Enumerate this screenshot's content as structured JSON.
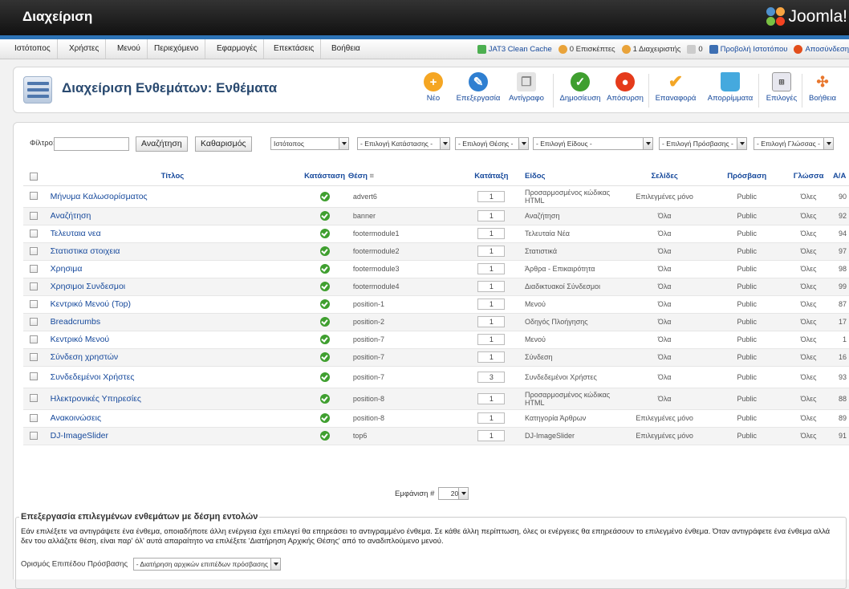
{
  "header": {
    "title": "Διαχείριση",
    "logo_text": "Joomla!"
  },
  "menu": [
    "Ιστότοπος",
    "Χρήστες",
    "Μενού",
    "Περιεχόμενο",
    "Εφαρμογές",
    "Επεκτάσεις",
    "Βοήθεια"
  ],
  "status": {
    "cache": "JAT3 Clean Cache",
    "visitors": "0 Επισκέπτες",
    "admins": "1 Διαχειριστής",
    "messages": "0",
    "view_site": "Προβολή Ιστοτόπου",
    "logout": "Αποσύνδεση"
  },
  "toolbar": {
    "page_title": "Διαχείριση Ενθεμάτων: Ενθέματα",
    "buttons": [
      "Νέο",
      "Επεξεργασία",
      "Αντίγραφο",
      "Δημοσίευση",
      "Απόσυρση",
      "Επαναφορά",
      "Απορρίμματα",
      "Επιλογές",
      "Βοήθεια"
    ]
  },
  "filter": {
    "label": "Φίλτρο:",
    "value": "",
    "search_button": "Αναζήτηση",
    "clear_button": "Καθαρισμός",
    "site_select": "Ιστότοπος",
    "state_select": "- Επιλογή Κατάστασης -",
    "position_select": "- Επιλογή Θέσης -",
    "type_select": "- Επιλογή Είδους -",
    "access_select": "- Επιλογή Πρόσβασης -",
    "language_select": "- Επιλογή Γλώσσας -"
  },
  "table": {
    "headers": {
      "title": "Τίτλος",
      "status": "Κατάσταση",
      "position": "Θέση",
      "ordering": "Κατάταξη",
      "type": "Είδος",
      "pages": "Σελίδες",
      "access": "Πρόσβαση",
      "language": "Γλώσσα",
      "id": "Α/Α"
    },
    "rows": [
      {
        "title": "Μήνυμα Καλωσορίσματος",
        "position": "advert6",
        "order": "1",
        "type": "Προσαρμοσμένος κώδικας HTML",
        "pages": "Επιλεγμένες μόνο",
        "access": "Public",
        "lang": "Όλες",
        "id": "90"
      },
      {
        "title": "Αναζήτηση",
        "position": "banner",
        "order": "1",
        "type": "Αναζήτηση",
        "pages": "Όλα",
        "access": "Public",
        "lang": "Όλες",
        "id": "92"
      },
      {
        "title": "Τελευταια νεα",
        "position": "footermodule1",
        "order": "1",
        "type": "Τελευταία Νέα",
        "pages": "Όλα",
        "access": "Public",
        "lang": "Όλες",
        "id": "94"
      },
      {
        "title": "Στατιστικα στοιχεια",
        "position": "footermodule2",
        "order": "1",
        "type": "Στατιστικά",
        "pages": "Όλα",
        "access": "Public",
        "lang": "Όλες",
        "id": "97"
      },
      {
        "title": "Χρησιμα",
        "position": "footermodule3",
        "order": "1",
        "type": "Άρθρα - Επικαιρότητα",
        "pages": "Όλα",
        "access": "Public",
        "lang": "Όλες",
        "id": "98"
      },
      {
        "title": "Χρησιμοι Συνδεσμοι",
        "position": "footermodule4",
        "order": "1",
        "type": "Διαδικτυακοί Σύνδεσμοι",
        "pages": "Όλα",
        "access": "Public",
        "lang": "Όλες",
        "id": "99"
      },
      {
        "title": "Κεντρικό Μενού (Top)",
        "position": "position-1",
        "order": "1",
        "type": "Μενού",
        "pages": "Όλα",
        "access": "Public",
        "lang": "Όλες",
        "id": "87"
      },
      {
        "title": "Breadcrumbs",
        "position": "position-2",
        "order": "1",
        "type": "Οδηγός Πλοήγησης",
        "pages": "Όλα",
        "access": "Public",
        "lang": "Όλες",
        "id": "17"
      },
      {
        "title": "Κεντρικό Μενού",
        "position": "position-7",
        "order": "1",
        "type": "Μενού",
        "pages": "Όλα",
        "access": "Public",
        "lang": "Όλες",
        "id": "1"
      },
      {
        "title": "Σύνδεση χρηστών",
        "position": "position-7",
        "order": "1",
        "type": "Σύνδεση",
        "pages": "Όλα",
        "access": "Public",
        "lang": "Όλες",
        "id": "16"
      },
      {
        "title": "Συνδεδεμένοι Χρήστες",
        "position": "position-7",
        "order": "3",
        "type": "Συνδεδεμένοι Χρήστες",
        "pages": "Όλα",
        "access": "Public",
        "lang": "Όλες",
        "id": "93"
      },
      {
        "title": "Ηλεκτρονικές Υπηρεσίες",
        "position": "position-8",
        "order": "1",
        "type": "Προσαρμοσμένος κώδικας HTML",
        "pages": "Όλα",
        "access": "Public",
        "lang": "Όλες",
        "id": "88"
      },
      {
        "title": "Ανακοινώσεις",
        "position": "position-8",
        "order": "1",
        "type": "Κατηγορία Άρθρων",
        "pages": "Επιλεγμένες μόνο",
        "access": "Public",
        "lang": "Όλες",
        "id": "89"
      },
      {
        "title": "DJ-ImageSlider",
        "position": "top6",
        "order": "1",
        "type": "DJ-ImageSlider",
        "pages": "Επιλεγμένες μόνο",
        "access": "Public",
        "lang": "Όλες",
        "id": "91"
      }
    ]
  },
  "pager": {
    "label": "Εμφάνιση #",
    "value": "20"
  },
  "batch": {
    "legend": "Επεξεργασία επιλεγμένων ενθεμάτων με δέσμη εντολών",
    "description": "Εάν επιλέξετε να αντιγράψετε ένα ένθεμα, οποιαδήποτε άλλη ενέργεια έχει επιλεγεί θα επηρεάσει το αντιγραμμένο ένθεμα. Σε κάθε άλλη περίπτωση, όλες οι ενέργειες θα επηρεάσουν το επιλεγμένο ένθεμα. Όταν αντιγράφετε ένα ένθεμα αλλά δεν του αλλάζετε θέση, είναι παρ' όλ' αυτά απαραίτητο να επιλέξετε 'Διατήρηση Αρχικής Θέσης' από το αναδιπλούμενο μενού.",
    "access_label": "Ορισμός Επιπέδου Πρόσβασης",
    "access_select": "- Διατήρηση αρχικών επιπέδων πρόσβασης -"
  },
  "colors": {
    "accent": "#2d73b6",
    "link": "#15489b",
    "ok": "#3f9f2f"
  }
}
